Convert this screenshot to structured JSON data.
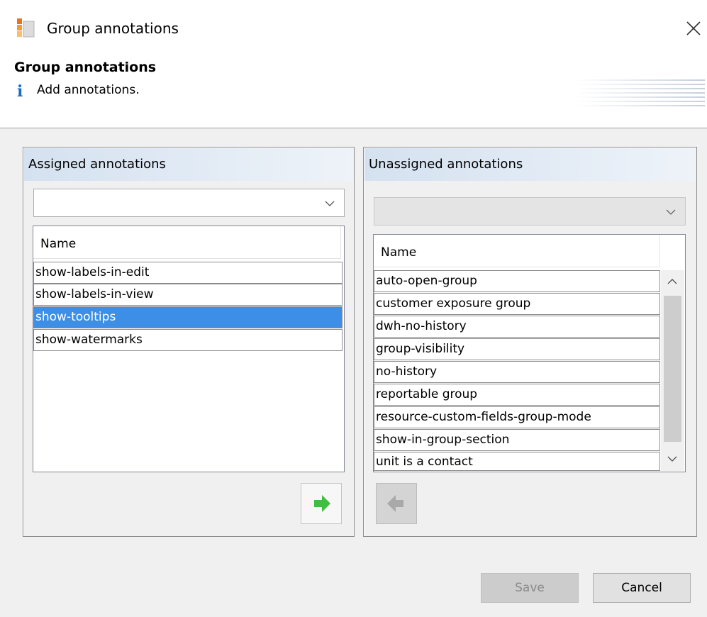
{
  "window": {
    "title": "Group annotations",
    "close_icon": "close-icon",
    "app_icon": "group-annotations-app-icon"
  },
  "header": {
    "title": "Group annotations",
    "description": "Add annotations.",
    "info_icon": "info-icon"
  },
  "assigned": {
    "title": "Assigned annotations",
    "filter_value": "",
    "column_header": "Name",
    "rows": [
      "show-labels-in-edit",
      "show-labels-in-view",
      "show-tooltips",
      "show-watermarks"
    ],
    "selected_row": "show-tooltips",
    "move_button_icon": "arrow-right-icon"
  },
  "unassigned": {
    "title": "Unassigned annotations",
    "filter_value": "",
    "column_header": "Name",
    "rows": [
      "auto-open-group",
      "customer exposure group",
      "dwh-no-history",
      "group-visibility",
      "no-history",
      "reportable group",
      "resource-custom-fields-group-mode",
      "show-in-group-section",
      "unit is a contact"
    ],
    "move_button_icon": "arrow-left-icon"
  },
  "footer": {
    "save_label": "Save",
    "cancel_label": "Cancel"
  },
  "colors": {
    "selection": "#3d8ee6",
    "move_arrow": "#3fbf3f",
    "info": "#1b6ec2"
  }
}
